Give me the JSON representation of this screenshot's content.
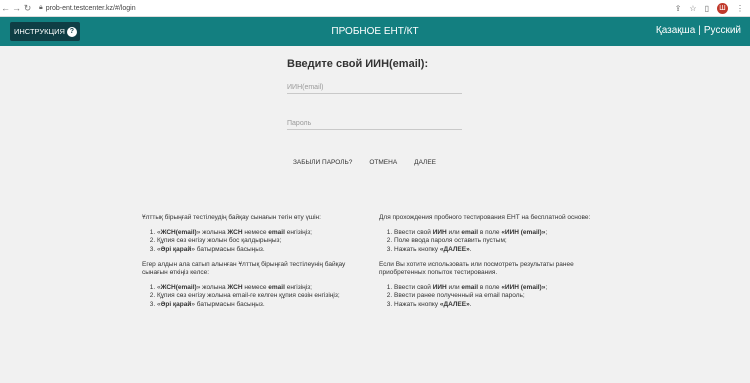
{
  "browser": {
    "url": "prob-ent.testcenter.kz/#/login",
    "profile_initial": "Ш"
  },
  "header": {
    "instruction_label": "ИНСТРУКЦИЯ",
    "title": "ПРОБНОЕ ЕНТ/КТ",
    "lang_kz": "Қазақша",
    "lang_sep": "|",
    "lang_ru": "Русский"
  },
  "login": {
    "title": "Введите свой ИИН(email):",
    "iin_placeholder": "ИИН(email)",
    "password_placeholder": "Пароль",
    "forgot_label": "ЗАБЫЛИ ПАРОЛЬ?",
    "cancel_label": "ОТМЕНА",
    "next_label": "ДАЛЕЕ"
  },
  "info_kz": {
    "intro": "Ұлттық бірыңғай тестілеудің байқау сынағын тегін өту үшін:",
    "steps1": [
      {
        "q1": "«",
        "b1": "ЖСН(email)",
        "t1": "» жолына ",
        "b2": "ЖСН",
        "t2": " немесе ",
        "b3": "email",
        "t3": " енгізіңіз;"
      },
      {
        "t1": "Құпия сөз енгізу жолын бос қалдырыңыз;"
      },
      {
        "q1": "«",
        "b1": "Әрі қарай",
        "t1": "» батырмасын басыңыз."
      }
    ],
    "intro2": "Егер алдын ала сатып алынған Ұлттық бірыңғай тестілеунің байқау сынағын өткіңіз келсе:",
    "steps2": [
      {
        "q1": "«",
        "b1": "ЖСН(email)",
        "t1": "» жолына ",
        "b2": "ЖСН",
        "t2": " немесе ",
        "b3": "email",
        "t3": " енгізіңіз;"
      },
      {
        "t1": "Құпия сөз енгізу жолына email-ге келген құпия сөзін енгізіңіз;"
      },
      {
        "q1": "«",
        "b1": "Әрі қарай",
        "t1": "» батырмасын басыңыз."
      }
    ]
  },
  "info_ru": {
    "intro": "Для прохождения пробного тестирования ЕНТ на бесплатной основе:",
    "steps1": [
      {
        "t1": "Ввести свой ",
        "b1": "ИИН",
        "t2": " или ",
        "b2": "email",
        "t3": " в поле ",
        "b3": "«ИИН (email)»",
        "t4": ";"
      },
      {
        "t1": "Поле ввода пароля оставить пустым;"
      },
      {
        "t1": "Нажать кнопку ",
        "b1": "«ДАЛЕЕ»",
        "t2": "."
      }
    ],
    "intro2": "Если Вы хотите использовать или посмотреть результаты ранее приобретенных попыток тестирования.",
    "steps2": [
      {
        "t1": "Ввести свой ",
        "b1": "ИИН",
        "t2": " или ",
        "b2": "email",
        "t3": " в поле ",
        "b3": "«ИИН (email)»",
        "t4": ";"
      },
      {
        "t1": "Ввести ранее полученный на email пароль;"
      },
      {
        "t1": "Нажать кнопку ",
        "b1": "«ДАЛЕЕ»",
        "t2": "."
      }
    ]
  }
}
